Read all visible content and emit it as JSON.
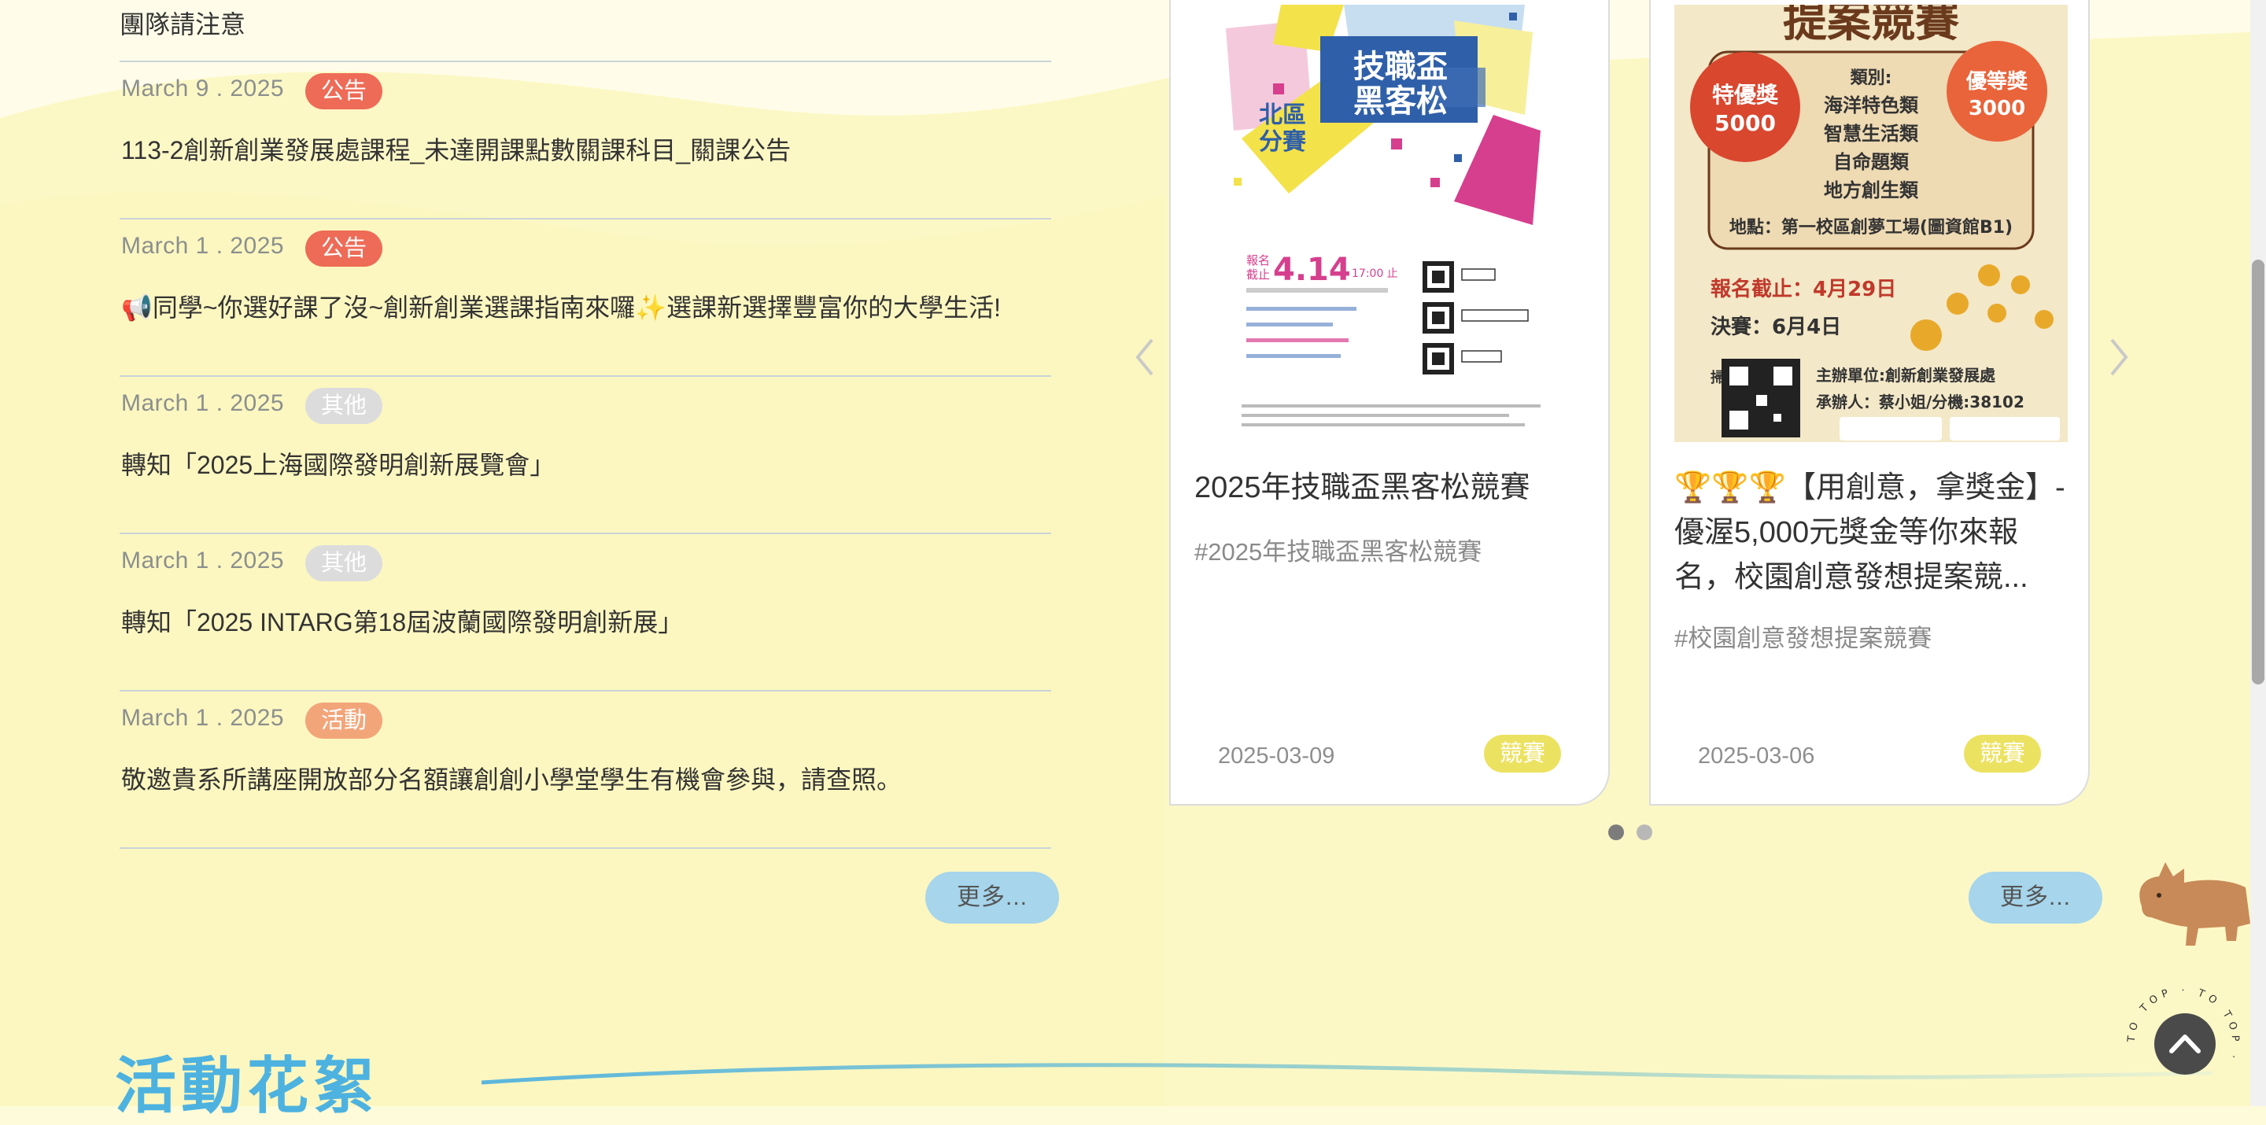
{
  "news": {
    "top_snippet": "團隊請注意",
    "items": [
      {
        "date": "March 9 . 2025",
        "tag": "公告",
        "tag_color": "#ee6b57",
        "title": "113-2創新創業發展處課程_未達開課點數關課科目_關課公告"
      },
      {
        "date": "March 1 . 2025",
        "tag": "公告",
        "tag_color": "#ee6b57",
        "title": "📢同學~你選好課了沒~創新創業選課指南來囉✨選課新選擇豐富你的大學生活!"
      },
      {
        "date": "March 1 . 2025",
        "tag": "其他",
        "tag_color": "#dcdcdc",
        "title": "轉知「2025上海國際發明創新展覽會」"
      },
      {
        "date": "March 1 . 2025",
        "tag": "其他",
        "tag_color": "#dcdcdc",
        "title": "轉知「2025 INTARG第18屆波蘭國際發明創新展」"
      },
      {
        "date": "March 1 . 2025",
        "tag": "活動",
        "tag_color": "#f3a57a",
        "title": "敬邀貴系所講座開放部分名額讓創創小學堂學生有機會參與，請查照。"
      }
    ],
    "more_label": "更多..."
  },
  "carousel": {
    "cards": [
      {
        "title": "2025年技職盃黑客松競賽",
        "hashtag": "#2025年技職盃黑客松競賽",
        "date": "2025-03-09",
        "badge": "競賽",
        "poster": {
          "headline_1": "技職盃",
          "headline_2": "黑客松",
          "side_1": "北區",
          "side_2": "分賽",
          "deadline_label_1": "報名",
          "deadline_label_2": "截止",
          "deadline": "4.14",
          "deadline_time": "17:00 止"
        }
      },
      {
        "title": "🏆🏆🏆【用創意，拿獎金】- 優渥5,000元獎金等你來報名，校園創意發想提案競...",
        "hashtag": "#校園創意發想提案競賽",
        "date": "2025-03-06",
        "badge": "競賽",
        "poster": {
          "headline": "提案競賽",
          "prize_1": "特優獎",
          "prize_1_amount": "5000",
          "prize_2": "優等獎",
          "prize_2_amount": "3000",
          "category_label": "類別:",
          "categories": [
            "海洋特色類",
            "智慧生活類",
            "自命題類",
            "地方創生類"
          ],
          "location": "地點：第一校區創夢工場(圖資館B1)",
          "deadline": "報名截止：4月29日",
          "final": "決賽：6月4日",
          "scan": "掃碼報名",
          "organizer": "主辦單位:創新創業發展處",
          "contact": "承辦人：蔡小姐/分機:38102"
        }
      }
    ],
    "more_label": "更多...",
    "dot_colors": [
      "#7c7c7c",
      "#b8b8b8"
    ]
  },
  "section": {
    "title": "活動花絮"
  },
  "totop": {
    "label": "TO TOP · TO TOP ·"
  },
  "colors": {
    "accent_blue": "#4db2e0",
    "badge_yellow": "#ece261",
    "background": "#fdfbd9"
  }
}
